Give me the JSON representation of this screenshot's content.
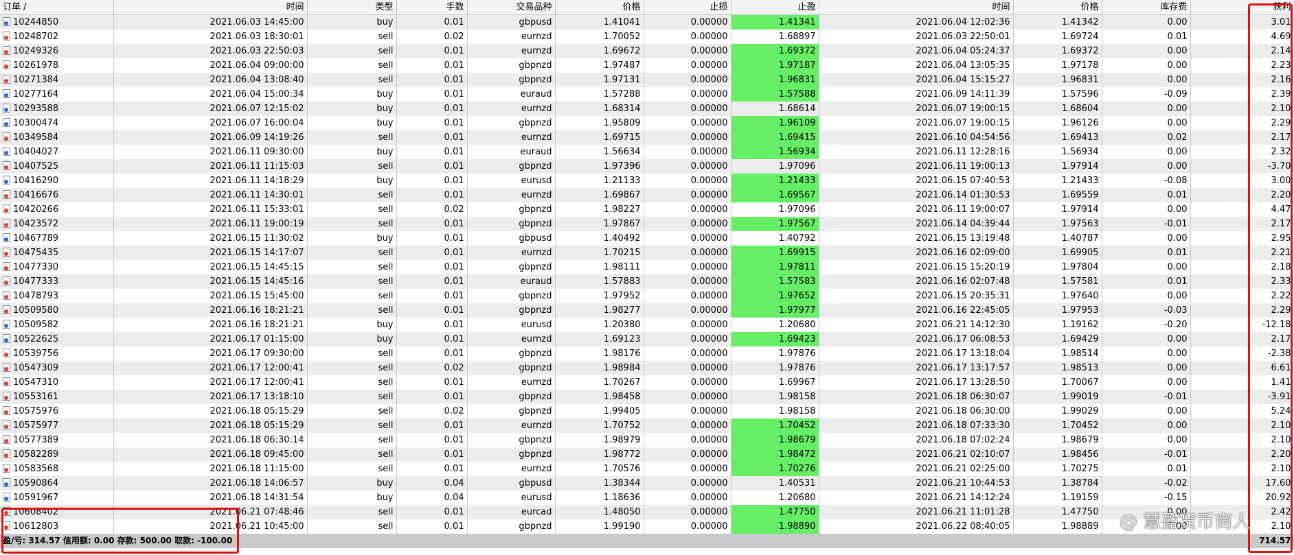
{
  "headers": {
    "order": "订单  /",
    "time": "时间",
    "type": "类型",
    "volume": "手数",
    "symbol": "交易品种",
    "price": "价格",
    "sl": "止损",
    "tp": "止盈",
    "close_time": "时间",
    "close_price": "价格",
    "swap": "库存费",
    "profit": "获利"
  },
  "rows": [
    {
      "order": "10244850",
      "time": "2021.06.03 14:45:00",
      "type": "buy",
      "volume": "0.01",
      "symbol": "gbpusd",
      "price": "1.41041",
      "sl": "0.00000",
      "tp": "1.41341",
      "tp_hit": true,
      "close_time": "2021.06.04 12:02:36",
      "close_price": "1.41342",
      "swap": "0.00",
      "profit": "3.01"
    },
    {
      "order": "10248702",
      "time": "2021.06.03 18:30:01",
      "type": "sell",
      "volume": "0.02",
      "symbol": "eurnzd",
      "price": "1.70052",
      "sl": "0.00000",
      "tp": "1.68897",
      "tp_hit": false,
      "close_time": "2021.06.03 22:50:01",
      "close_price": "1.69724",
      "swap": "0.01",
      "profit": "4.69"
    },
    {
      "order": "10249326",
      "time": "2021.06.03 22:50:03",
      "type": "sell",
      "volume": "0.01",
      "symbol": "eurnzd",
      "price": "1.69672",
      "sl": "0.00000",
      "tp": "1.69372",
      "tp_hit": true,
      "close_time": "2021.06.04 05:24:37",
      "close_price": "1.69372",
      "swap": "0.00",
      "profit": "2.14"
    },
    {
      "order": "10261978",
      "time": "2021.06.04 09:00:00",
      "type": "sell",
      "volume": "0.01",
      "symbol": "gbpnzd",
      "price": "1.97487",
      "sl": "0.00000",
      "tp": "1.97187",
      "tp_hit": true,
      "close_time": "2021.06.04 13:05:35",
      "close_price": "1.97178",
      "swap": "0.00",
      "profit": "2.23"
    },
    {
      "order": "10271384",
      "time": "2021.06.04 13:08:40",
      "type": "sell",
      "volume": "0.01",
      "symbol": "gbpnzd",
      "price": "1.97131",
      "sl": "0.00000",
      "tp": "1.96831",
      "tp_hit": true,
      "close_time": "2021.06.04 15:15:27",
      "close_price": "1.96831",
      "swap": "0.00",
      "profit": "2.16"
    },
    {
      "order": "10277164",
      "time": "2021.06.04 15:00:34",
      "type": "buy",
      "volume": "0.01",
      "symbol": "euraud",
      "price": "1.57288",
      "sl": "0.00000",
      "tp": "1.57588",
      "tp_hit": true,
      "close_time": "2021.06.09 14:11:39",
      "close_price": "1.57596",
      "swap": "-0.09",
      "profit": "2.39"
    },
    {
      "order": "10293588",
      "time": "2021.06.07 12:15:02",
      "type": "buy",
      "volume": "0.01",
      "symbol": "eurnzd",
      "price": "1.68314",
      "sl": "0.00000",
      "tp": "1.68614",
      "tp_hit": false,
      "close_time": "2021.06.07 19:00:15",
      "close_price": "1.68604",
      "swap": "0.00",
      "profit": "2.10"
    },
    {
      "order": "10300474",
      "time": "2021.06.07 16:00:04",
      "type": "buy",
      "volume": "0.01",
      "symbol": "gbpnzd",
      "price": "1.95809",
      "sl": "0.00000",
      "tp": "1.96109",
      "tp_hit": true,
      "close_time": "2021.06.07 19:00:15",
      "close_price": "1.96126",
      "swap": "0.00",
      "profit": "2.29"
    },
    {
      "order": "10349584",
      "time": "2021.06.09 14:19:26",
      "type": "sell",
      "volume": "0.01",
      "symbol": "eurnzd",
      "price": "1.69715",
      "sl": "0.00000",
      "tp": "1.69415",
      "tp_hit": true,
      "close_time": "2021.06.10 04:54:56",
      "close_price": "1.69413",
      "swap": "0.02",
      "profit": "2.17"
    },
    {
      "order": "10404027",
      "time": "2021.06.11 09:30:00",
      "type": "buy",
      "volume": "0.01",
      "symbol": "euraud",
      "price": "1.56634",
      "sl": "0.00000",
      "tp": "1.56934",
      "tp_hit": true,
      "close_time": "2021.06.11 12:28:16",
      "close_price": "1.56934",
      "swap": "0.00",
      "profit": "2.32"
    },
    {
      "order": "10407525",
      "time": "2021.06.11 11:15:03",
      "type": "sell",
      "volume": "0.01",
      "symbol": "gbpnzd",
      "price": "1.97396",
      "sl": "0.00000",
      "tp": "1.97096",
      "tp_hit": false,
      "close_time": "2021.06.11 19:00:13",
      "close_price": "1.97914",
      "swap": "0.00",
      "profit": "-3.70"
    },
    {
      "order": "10416290",
      "time": "2021.06.11 14:18:29",
      "type": "buy",
      "volume": "0.01",
      "symbol": "eurusd",
      "price": "1.21133",
      "sl": "0.00000",
      "tp": "1.21433",
      "tp_hit": true,
      "close_time": "2021.06.15 07:40:53",
      "close_price": "1.21433",
      "swap": "-0.08",
      "profit": "3.00"
    },
    {
      "order": "10416676",
      "time": "2021.06.11 14:30:01",
      "type": "sell",
      "volume": "0.01",
      "symbol": "eurnzd",
      "price": "1.69867",
      "sl": "0.00000",
      "tp": "1.69567",
      "tp_hit": true,
      "close_time": "2021.06.14 01:30:53",
      "close_price": "1.69559",
      "swap": "0.01",
      "profit": "2.20"
    },
    {
      "order": "10420266",
      "time": "2021.06.11 15:33:01",
      "type": "sell",
      "volume": "0.02",
      "symbol": "gbpnzd",
      "price": "1.98227",
      "sl": "0.00000",
      "tp": "1.97096",
      "tp_hit": false,
      "close_time": "2021.06.11 19:00:07",
      "close_price": "1.97914",
      "swap": "0.00",
      "profit": "4.47"
    },
    {
      "order": "10423572",
      "time": "2021.06.11 19:00:19",
      "type": "sell",
      "volume": "0.01",
      "symbol": "gbpnzd",
      "price": "1.97867",
      "sl": "0.00000",
      "tp": "1.97567",
      "tp_hit": true,
      "close_time": "2021.06.14 04:39:44",
      "close_price": "1.97563",
      "swap": "-0.01",
      "profit": "2.17"
    },
    {
      "order": "10467789",
      "time": "2021.06.15 11:30:02",
      "type": "buy",
      "volume": "0.01",
      "symbol": "gbpusd",
      "price": "1.40492",
      "sl": "0.00000",
      "tp": "1.40792",
      "tp_hit": false,
      "close_time": "2021.06.15 13:19:48",
      "close_price": "1.40787",
      "swap": "0.00",
      "profit": "2.95"
    },
    {
      "order": "10475435",
      "time": "2021.06.15 14:17:07",
      "type": "sell",
      "volume": "0.01",
      "symbol": "eurnzd",
      "price": "1.70215",
      "sl": "0.00000",
      "tp": "1.69915",
      "tp_hit": true,
      "close_time": "2021.06.16 02:09:00",
      "close_price": "1.69905",
      "swap": "0.01",
      "profit": "2.21"
    },
    {
      "order": "10477330",
      "time": "2021.06.15 14:45:15",
      "type": "sell",
      "volume": "0.01",
      "symbol": "gbpnzd",
      "price": "1.98111",
      "sl": "0.00000",
      "tp": "1.97811",
      "tp_hit": true,
      "close_time": "2021.06.15 15:20:19",
      "close_price": "1.97804",
      "swap": "0.00",
      "profit": "2.18"
    },
    {
      "order": "10477333",
      "time": "2021.06.15 14:45:16",
      "type": "sell",
      "volume": "0.01",
      "symbol": "euraud",
      "price": "1.57883",
      "sl": "0.00000",
      "tp": "1.57583",
      "tp_hit": true,
      "close_time": "2021.06.16 02:07:48",
      "close_price": "1.57581",
      "swap": "0.01",
      "profit": "2.33"
    },
    {
      "order": "10478793",
      "time": "2021.06.15 15:45:00",
      "type": "sell",
      "volume": "0.01",
      "symbol": "gbpnzd",
      "price": "1.97952",
      "sl": "0.00000",
      "tp": "1.97652",
      "tp_hit": true,
      "close_time": "2021.06.15 20:35:31",
      "close_price": "1.97640",
      "swap": "0.00",
      "profit": "2.22"
    },
    {
      "order": "10509580",
      "time": "2021.06.16 18:21:21",
      "type": "sell",
      "volume": "0.01",
      "symbol": "gbpnzd",
      "price": "1.98277",
      "sl": "0.00000",
      "tp": "1.97977",
      "tp_hit": true,
      "close_time": "2021.06.16 22:45:05",
      "close_price": "1.97953",
      "swap": "-0.03",
      "profit": "2.29"
    },
    {
      "order": "10509582",
      "time": "2021.06.16 18:21:21",
      "type": "buy",
      "volume": "0.01",
      "symbol": "eurusd",
      "price": "1.20380",
      "sl": "0.00000",
      "tp": "1.20680",
      "tp_hit": false,
      "close_time": "2021.06.21 14:12:30",
      "close_price": "1.19162",
      "swap": "-0.20",
      "profit": "-12.18"
    },
    {
      "order": "10522625",
      "time": "2021.06.17 01:15:00",
      "type": "buy",
      "volume": "0.01",
      "symbol": "eurnzd",
      "price": "1.69123",
      "sl": "0.00000",
      "tp": "1.69423",
      "tp_hit": true,
      "close_time": "2021.06.17 06:08:53",
      "close_price": "1.69429",
      "swap": "0.00",
      "profit": "2.17"
    },
    {
      "order": "10539756",
      "time": "2021.06.17 09:30:00",
      "type": "sell",
      "volume": "0.01",
      "symbol": "gbpnzd",
      "price": "1.98176",
      "sl": "0.00000",
      "tp": "1.97876",
      "tp_hit": false,
      "close_time": "2021.06.17 13:18:04",
      "close_price": "1.98514",
      "swap": "0.00",
      "profit": "-2.38"
    },
    {
      "order": "10547309",
      "time": "2021.06.17 12:00:41",
      "type": "sell",
      "volume": "0.02",
      "symbol": "gbpnzd",
      "price": "1.98984",
      "sl": "0.00000",
      "tp": "1.97876",
      "tp_hit": false,
      "close_time": "2021.06.17 13:17:57",
      "close_price": "1.98513",
      "swap": "0.00",
      "profit": "6.61"
    },
    {
      "order": "10547310",
      "time": "2021.06.17 12:00:41",
      "type": "sell",
      "volume": "0.01",
      "symbol": "eurnzd",
      "price": "1.70267",
      "sl": "0.00000",
      "tp": "1.69967",
      "tp_hit": false,
      "close_time": "2021.06.17 13:28:50",
      "close_price": "1.70067",
      "swap": "0.00",
      "profit": "1.41"
    },
    {
      "order": "10553161",
      "time": "2021.06.17 13:18:10",
      "type": "sell",
      "volume": "0.01",
      "symbol": "gbpnzd",
      "price": "1.98458",
      "sl": "0.00000",
      "tp": "1.98158",
      "tp_hit": false,
      "close_time": "2021.06.18 06:30:07",
      "close_price": "1.99019",
      "swap": "-0.01",
      "profit": "-3.91"
    },
    {
      "order": "10575976",
      "time": "2021.06.18 05:15:29",
      "type": "sell",
      "volume": "0.02",
      "symbol": "gbpnzd",
      "price": "1.99405",
      "sl": "0.00000",
      "tp": "1.98158",
      "tp_hit": false,
      "close_time": "2021.06.18 06:30:00",
      "close_price": "1.99029",
      "swap": "0.00",
      "profit": "5.24"
    },
    {
      "order": "10575977",
      "time": "2021.06.18 05:15:29",
      "type": "sell",
      "volume": "0.01",
      "symbol": "eurnzd",
      "price": "1.70752",
      "sl": "0.00000",
      "tp": "1.70452",
      "tp_hit": true,
      "close_time": "2021.06.18 07:33:30",
      "close_price": "1.70452",
      "swap": "0.00",
      "profit": "2.10"
    },
    {
      "order": "10577389",
      "time": "2021.06.18 06:30:14",
      "type": "sell",
      "volume": "0.01",
      "symbol": "gbpnzd",
      "price": "1.98979",
      "sl": "0.00000",
      "tp": "1.98679",
      "tp_hit": true,
      "close_time": "2021.06.18 07:02:24",
      "close_price": "1.98679",
      "swap": "0.00",
      "profit": "2.10"
    },
    {
      "order": "10582289",
      "time": "2021.06.18 09:45:00",
      "type": "sell",
      "volume": "0.01",
      "symbol": "gbpnzd",
      "price": "1.98772",
      "sl": "0.00000",
      "tp": "1.98472",
      "tp_hit": true,
      "close_time": "2021.06.21 02:10:07",
      "close_price": "1.98456",
      "swap": "-0.01",
      "profit": "2.20"
    },
    {
      "order": "10583568",
      "time": "2021.06.18 11:15:00",
      "type": "sell",
      "volume": "0.01",
      "symbol": "eurnzd",
      "price": "1.70576",
      "sl": "0.00000",
      "tp": "1.70276",
      "tp_hit": true,
      "close_time": "2021.06.21 02:25:00",
      "close_price": "1.70275",
      "swap": "0.01",
      "profit": "2.10"
    },
    {
      "order": "10590864",
      "time": "2021.06.18 14:06:57",
      "type": "buy",
      "volume": "0.04",
      "symbol": "gbpusd",
      "price": "1.38344",
      "sl": "0.00000",
      "tp": "1.40531",
      "tp_hit": false,
      "close_time": "2021.06.21 10:44:53",
      "close_price": "1.38784",
      "swap": "-0.02",
      "profit": "17.60"
    },
    {
      "order": "10591967",
      "time": "2021.06.18 14:31:54",
      "type": "buy",
      "volume": "0.04",
      "symbol": "eurusd",
      "price": "1.18636",
      "sl": "0.00000",
      "tp": "1.20680",
      "tp_hit": false,
      "close_time": "2021.06.21 14:12:24",
      "close_price": "1.19159",
      "swap": "-0.15",
      "profit": "20.92"
    },
    {
      "order": "10608402",
      "time": "2021.06.21 07:48:46",
      "type": "sell",
      "volume": "0.01",
      "symbol": "eurcad",
      "price": "1.48050",
      "sl": "0.00000",
      "tp": "1.47750",
      "tp_hit": true,
      "close_time": "2021.06.21 11:01:28",
      "close_price": "1.47750",
      "swap": "0.00",
      "profit": "2.42"
    },
    {
      "order": "10612803",
      "time": "2021.06.21 10:45:00",
      "type": "sell",
      "volume": "0.01",
      "symbol": "gbpnzd",
      "price": "1.99190",
      "sl": "0.00000",
      "tp": "1.98890",
      "tp_hit": true,
      "close_time": "2021.06.22 08:40:05",
      "close_price": "1.98889",
      "swap": "0.00",
      "profit": "2.10"
    }
  ],
  "footer": {
    "summary": "盈/亏: 314.57  信用额: 0.00  存款: 500.00  取款: -100.00",
    "total_profit": "714.57"
  },
  "watermark": "@ 慧盈货币商人",
  "colors": {
    "tp_hit": "#66ee66",
    "highlight_box": "#e01010"
  }
}
